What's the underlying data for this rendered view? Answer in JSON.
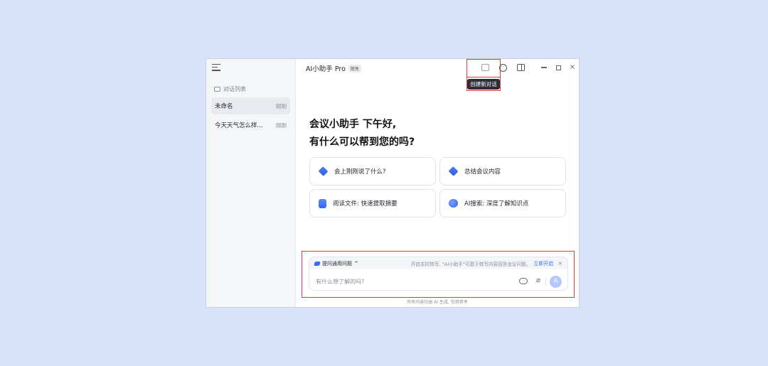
{
  "header": {
    "title": "AI小助手 Pro",
    "badge": "限免",
    "tooltip": "创建新对话"
  },
  "sidebar": {
    "list_title": "对话列表",
    "items": [
      {
        "label": "未命名",
        "time": "刚刚"
      },
      {
        "label": "今天天气怎么样...",
        "time": "刚刚"
      }
    ]
  },
  "main": {
    "greeting_line1": "会议小助手 下午好,",
    "greeting_line2": "有什么可以帮到您的吗?",
    "cards": [
      {
        "label": "会上刚刚说了什么?",
        "icon": "layers-icon"
      },
      {
        "label": "总结会议内容",
        "icon": "layers-icon"
      },
      {
        "label": "阅读文件: 快速提取摘要",
        "icon": "book-icon"
      },
      {
        "label": "AI搜索: 深度了解知识点",
        "icon": "planet-icon"
      }
    ]
  },
  "input": {
    "mode_label": "提问通用问题",
    "tip": "开启实时转写, \"AI小助手\"可基于转写内容回答会议问题。",
    "open_label": "立即开启",
    "placeholder": "有什么想了解的吗?",
    "send_glyph": "A"
  },
  "footer": {
    "disclaimer": "所有内容均由 AI 生成, 仅供参考"
  },
  "colors": {
    "background": "#d6e3fb",
    "accent": "#3370ff",
    "highlight": "#e03a3a"
  }
}
